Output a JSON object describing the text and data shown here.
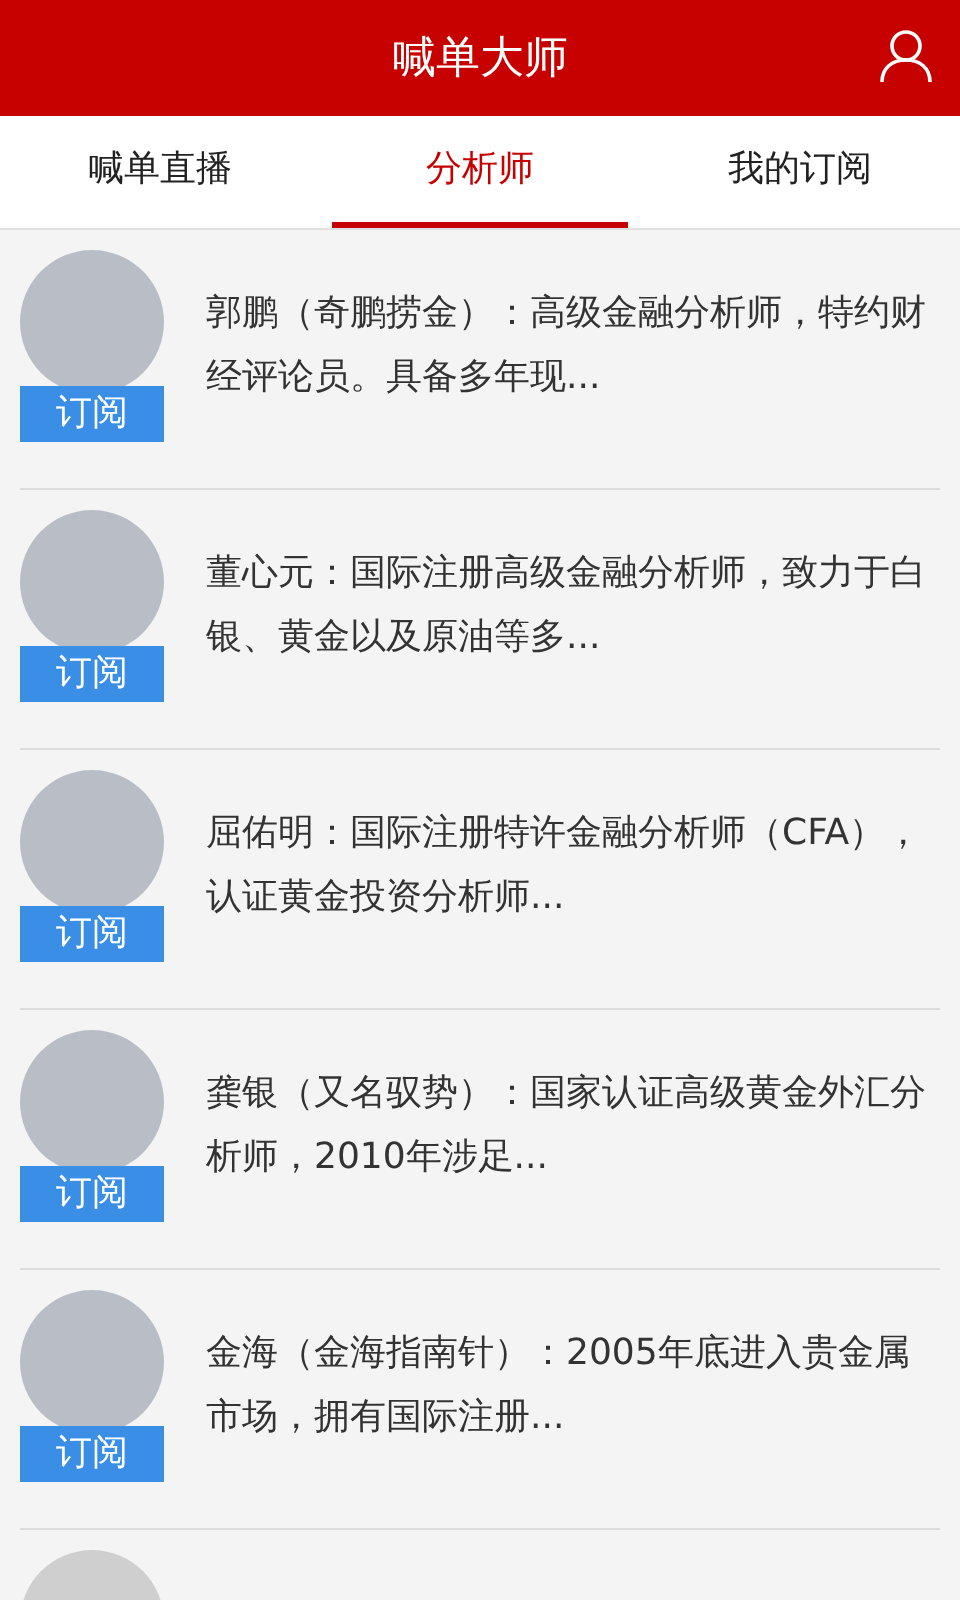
{
  "header": {
    "title": "喊单大师"
  },
  "tabs": [
    {
      "label": "喊单直播",
      "selected": false
    },
    {
      "label": "分析师",
      "selected": true
    },
    {
      "label": "我的订阅",
      "selected": false
    }
  ],
  "analysts": [
    {
      "description": "郭鹏（奇鹏捞金）：高级金融分析师，特约财经评论员。具备多年现...",
      "button": "订阅"
    },
    {
      "description": "董心元：国际注册高级金融分析师，致力于白银、黄金以及原油等多...",
      "button": "订阅"
    },
    {
      "description": "屈佑明：国际注册特许金融分析师（CFA），认证黄金投资分析师...",
      "button": "订阅"
    },
    {
      "description": "龚银（又名驭势）：国家认证高级黄金外汇分析师，2010年涉足...",
      "button": "订阅"
    },
    {
      "description": "金海（金海指南针）：2005年底进入贵金属市场，拥有国际注册...",
      "button": "订阅"
    }
  ]
}
